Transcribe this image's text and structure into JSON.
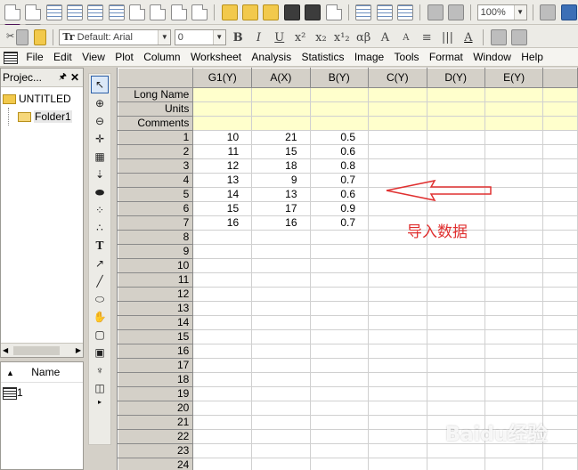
{
  "toolbar": {
    "zoom": "100%",
    "font_name": "Default: Arial",
    "font_size": "0",
    "fmt_bold": "B",
    "fmt_italic": "I",
    "fmt_underline": "U",
    "fmt_super": "x²",
    "fmt_sub": "x₂",
    "fmt_supsub": "x¹₂",
    "fmt_greek": "αβ",
    "fmt_grow": "A",
    "fmt_shrink": "A",
    "fmt_color": "A"
  },
  "menu": [
    "File",
    "Edit",
    "View",
    "Plot",
    "Column",
    "Worksheet",
    "Analysis",
    "Statistics",
    "Image",
    "Tools",
    "Format",
    "Window",
    "Help"
  ],
  "project": {
    "title": "Projec...",
    "root": "UNTITLED",
    "folder": "Folder1",
    "name_header": "Name",
    "item": "1"
  },
  "sheet": {
    "columns": [
      "G1(Y)",
      "A(X)",
      "B(Y)",
      "C(Y)",
      "D(Y)",
      "E(Y)"
    ],
    "meta_rows": [
      "Long Name",
      "Units",
      "Comments"
    ],
    "rows": [
      {
        "n": "1",
        "g1": "10",
        "a": "21",
        "b": "0.5"
      },
      {
        "n": "2",
        "g1": "11",
        "a": "15",
        "b": "0.6"
      },
      {
        "n": "3",
        "g1": "12",
        "a": "18",
        "b": "0.8"
      },
      {
        "n": "4",
        "g1": "13",
        "a": "9",
        "b": "0.7"
      },
      {
        "n": "5",
        "g1": "14",
        "a": "13",
        "b": "0.6"
      },
      {
        "n": "6",
        "g1": "15",
        "a": "17",
        "b": "0.9"
      },
      {
        "n": "7",
        "g1": "16",
        "a": "16",
        "b": "0.7"
      },
      {
        "n": "8"
      },
      {
        "n": "9"
      },
      {
        "n": "10"
      },
      {
        "n": "11"
      },
      {
        "n": "12"
      },
      {
        "n": "13"
      },
      {
        "n": "14"
      },
      {
        "n": "15"
      },
      {
        "n": "16"
      },
      {
        "n": "17"
      },
      {
        "n": "18"
      },
      {
        "n": "19"
      },
      {
        "n": "20"
      },
      {
        "n": "21"
      },
      {
        "n": "22"
      },
      {
        "n": "23"
      },
      {
        "n": "24"
      }
    ]
  },
  "annotation": {
    "text": "导入数据",
    "color": "#e03030"
  },
  "watermark": "Baidu经验"
}
